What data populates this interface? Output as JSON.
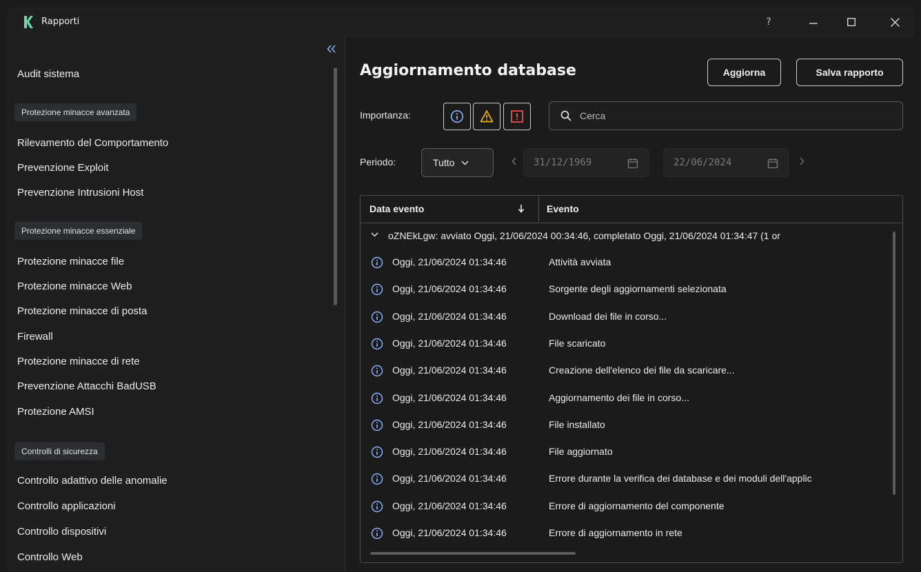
{
  "window": {
    "title": "Rapporti",
    "help_label": "?",
    "accent_color": "#6fd4a8"
  },
  "sidebar": {
    "collapse_label": "«",
    "items": [
      {
        "label": "Audit sistema"
      },
      {
        "group": "Protezione minacce avanzata"
      },
      {
        "label": "Rilevamento del Comportamento"
      },
      {
        "label": "Prevenzione Exploit"
      },
      {
        "label": "Prevenzione Intrusioni Host"
      },
      {
        "group": "Protezione minacce essenziale"
      },
      {
        "label": "Protezione minacce file"
      },
      {
        "label": "Protezione minacce Web"
      },
      {
        "label": "Protezione minacce di posta"
      },
      {
        "label": "Firewall"
      },
      {
        "label": "Protezione minacce di rete"
      },
      {
        "label": "Prevenzione Attacchi BadUSB"
      },
      {
        "label": "Protezione AMSI"
      },
      {
        "group": "Controlli di sicurezza"
      },
      {
        "label": "Controllo adattivo delle anomalie"
      },
      {
        "label": "Controllo applicazioni"
      },
      {
        "label": "Controllo dispositivi"
      },
      {
        "label": "Controllo Web"
      }
    ]
  },
  "main": {
    "title": "Aggiornamento database",
    "refresh_label": "Aggiorna",
    "save_label": "Salva rapporto",
    "importance_label": "Importanza:",
    "search_placeholder": "Cerca",
    "period_label": "Periodo:",
    "period_value": "Tutto",
    "date_from": "31/12/1969",
    "date_to": "22/06/2024",
    "severity_colors": {
      "info": "#8ab4ff",
      "warning": "#f5b800",
      "critical": "#ff4d4d"
    }
  },
  "table": {
    "col_date": "Data evento",
    "col_event": "Evento",
    "group_row": "oZNEkLgw: avviato Oggi, 21/06/2024 00:34:46, completato Oggi, 21/06/2024 01:34:47 (1 or",
    "rows": [
      {
        "date": "Oggi, 21/06/2024 01:34:46",
        "event": "Attività avviata"
      },
      {
        "date": "Oggi, 21/06/2024 01:34:46",
        "event": "Sorgente degli aggiornamenti selezionata"
      },
      {
        "date": "Oggi, 21/06/2024 01:34:46",
        "event": "Download dei file in corso..."
      },
      {
        "date": "Oggi, 21/06/2024 01:34:46",
        "event": "File scaricato"
      },
      {
        "date": "Oggi, 21/06/2024 01:34:46",
        "event": "Creazione dell'elenco dei file da scaricare..."
      },
      {
        "date": "Oggi, 21/06/2024 01:34:46",
        "event": "Aggiornamento dei file in corso..."
      },
      {
        "date": "Oggi, 21/06/2024 01:34:46",
        "event": "File installato"
      },
      {
        "date": "Oggi, 21/06/2024 01:34:46",
        "event": "File aggiornato"
      },
      {
        "date": "Oggi, 21/06/2024 01:34:46",
        "event": "Errore durante la verifica dei database e dei moduli dell'applic"
      },
      {
        "date": "Oggi, 21/06/2024 01:34:46",
        "event": "Errore di aggiornamento del componente"
      },
      {
        "date": "Oggi, 21/06/2024 01:34:46",
        "event": "Errore di aggiornamento in rete"
      }
    ]
  }
}
